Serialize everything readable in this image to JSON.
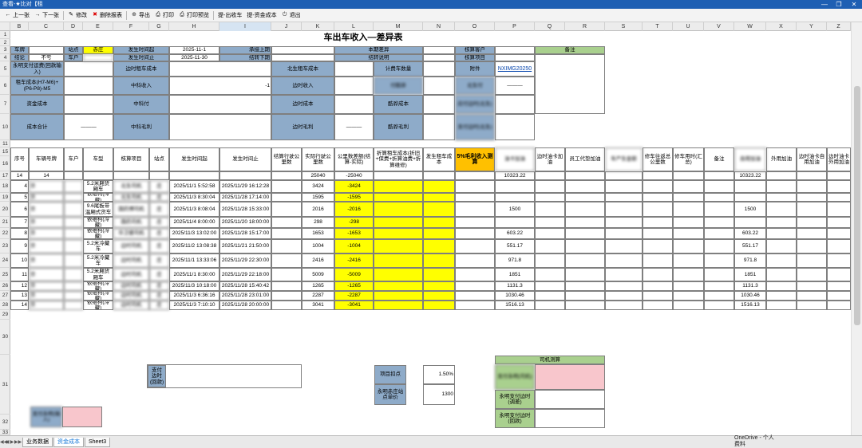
{
  "window": {
    "title": "查看-★比对【租",
    "minimize": "—",
    "restore": "❐",
    "close": "✕"
  },
  "toolbar": [
    {
      "label": "上一张",
      "icon": "arrow-left-icon",
      "glyph": "←"
    },
    {
      "label": "下一张",
      "icon": "arrow-right-icon",
      "glyph": "→"
    },
    {
      "label": "修改",
      "icon": "edit-icon",
      "glyph": "✎"
    },
    {
      "label": "删除报表",
      "icon": "delete-icon",
      "glyph": "✖"
    },
    {
      "label": "导出",
      "icon": "export-icon",
      "glyph": "⊕"
    },
    {
      "label": "打印",
      "icon": "print-icon",
      "glyph": "⎙"
    },
    {
      "label": "打印预览",
      "icon": "print-preview-icon",
      "glyph": "⎙"
    },
    {
      "label": "提-出收车",
      "icon": "",
      "glyph": ""
    },
    {
      "label": "提-资金成本",
      "icon": "",
      "glyph": ""
    },
    {
      "label": "退出",
      "icon": "exit-icon",
      "glyph": "⏻"
    }
  ],
  "columns": [
    "B",
    "C",
    "D",
    "E",
    "F",
    "G",
    "H",
    "I",
    "J",
    "K",
    "L",
    "M",
    "N",
    "O",
    "P",
    "Q",
    "R",
    "S",
    "T",
    "U",
    "V",
    "W",
    "X",
    "Y",
    "Z"
  ],
  "rows": [
    "1",
    "2",
    "3",
    "4",
    "5",
    "6",
    "7",
    "10",
    "11",
    "15",
    "16",
    "17",
    "18",
    "19",
    "20",
    "21",
    "22",
    "23",
    "24",
    "25",
    "26",
    "27",
    "28",
    "29",
    "30",
    "31",
    "32",
    "33"
  ],
  "sheet": {
    "title": "车出车收入—差异表",
    "l3": [
      "车牌",
      "",
      "站点",
      "赤庄",
      "发生时间起",
      "2025-11-1",
      "承接上期",
      "",
      "本期差异",
      "",
      "核算客户",
      "",
      "备注"
    ],
    "l4": [
      "结论",
      "不亏",
      "车户",
      "",
      "发生时间止",
      "2025-11-30",
      "结转下期",
      "",
      "结转说明",
      "",
      "核算项目",
      ""
    ],
    "l5": [
      "永明支付运费(回款输入)",
      "",
      "边时租车成本",
      "",
      "北生租车成本",
      "",
      "计费车数量",
      "",
      "附件",
      "NXIMG20250",
      ""
    ],
    "l6": [
      "租车成本(H7-M6)+(P6-P8)-M5",
      "",
      "中科收入",
      "-1",
      "边时收入",
      "",
      "付酷骅",
      "",
      "北生付",
      "———"
    ],
    "l7": [
      "资金成本",
      "",
      "中科付",
      "",
      "边时成本",
      "",
      "酷骅成本",
      "",
      "应付边时(北生)",
      ""
    ],
    "l8": [
      "成本合计",
      "———",
      "中科毛利",
      "",
      "边时毛利",
      "———",
      "酷骅毛利",
      "",
      "支付边时(北生)",
      ""
    ],
    "hdr": [
      "序号",
      "车辆号牌",
      "车户",
      "车型",
      "核算项目",
      "站点",
      "发生时间起",
      "发生时间止",
      "结算行驶公里数",
      "实际行驶公里数",
      "公里数差额(结算-实际)",
      "折算租车成本(折旧+保费+折算油费+折算维修)",
      "发生租车成本",
      "5%毛利收入测算",
      "油卡加油",
      "边时油卡加油",
      "员工代垫加油",
      "车产生金额",
      "修车往返总公里数",
      "修车用时(汇总)",
      "备注",
      "自用加油",
      "外用加油",
      "边时油卡自用加油",
      "边时油卡外用加油"
    ],
    "sum": [
      "14",
      "14",
      "",
      "",
      "",
      "",
      "",
      "",
      "",
      "25040",
      "-25040",
      "",
      "",
      "",
      "10323.22",
      "",
      "",
      "",
      "",
      "",
      "",
      "10323.22",
      "",
      "",
      ""
    ],
    "data": [
      [
        "4",
        "京",
        "",
        "5.2米厢货厢车",
        "北生司机",
        "庄",
        "2025/11/1 5:52:58",
        "2025/11/29 16:12:28",
        "",
        "3424",
        "-3424",
        "",
        "",
        "",
        "",
        "",
        "",
        "",
        "",
        "",
        "",
        "",
        "",
        "",
        ""
      ],
      [
        "5",
        "京",
        "",
        "依维柯(冷藏)",
        "北生司机",
        "庄",
        "2025/11/3 8:30:04",
        "2025/11/28 17:14:00",
        "",
        "1595",
        "-1595",
        "",
        "",
        "",
        "",
        "",
        "",
        "",
        "",
        "",
        "",
        "",
        "",
        "",
        ""
      ],
      [
        "6",
        "京",
        "",
        "9.6尾板带温厢式货车",
        "国药博司机",
        "庄",
        "2025/11/3 8:08:04",
        "2025/11/28 15:33:00",
        "",
        "2016",
        "-2016",
        "",
        "",
        "",
        "1500",
        "",
        "",
        "",
        "",
        "",
        "",
        "1500",
        "",
        "",
        ""
      ],
      [
        "7",
        "京",
        "",
        "依维柯(冷藏)",
        "国药司机",
        "庄",
        "2025/11/4 8:00:00",
        "2025/11/20 18:00:00",
        "",
        "298",
        "-298",
        "",
        "",
        "",
        "",
        "",
        "",
        "",
        "",
        "",
        "",
        "",
        "",
        "",
        ""
      ],
      [
        "8",
        "京",
        "",
        "依维柯(冷藏)",
        "华卫健司机",
        "庄",
        "2025/11/3 13:02:00",
        "2025/11/28 15:17:00",
        "",
        "1653",
        "-1653",
        "",
        "",
        "",
        "603.22",
        "",
        "",
        "",
        "",
        "",
        "",
        "603.22",
        "",
        "",
        ""
      ],
      [
        "9",
        "京",
        "",
        "5.2米冷藏车",
        "边时司机",
        "庄",
        "2025/11/2 13:08:38",
        "2025/11/21 21:50:00",
        "",
        "1004",
        "-1004",
        "",
        "",
        "",
        "551.17",
        "",
        "",
        "",
        "",
        "",
        "",
        "551.17",
        "",
        "",
        ""
      ],
      [
        "10",
        "京",
        "",
        "5.2米冷藏车",
        "边时司机",
        "庄",
        "2025/11/1 13:33:06",
        "2025/11/29 22:30:00",
        "",
        "2416",
        "-2416",
        "",
        "",
        "",
        "971.8",
        "",
        "",
        "",
        "",
        "",
        "",
        "971.8",
        "",
        "",
        ""
      ],
      [
        "11",
        "京",
        "",
        "5.2米厢货厢车",
        "边时司机",
        "庄",
        "2025/11/1 8:30:00",
        "2025/11/29 22:18:00",
        "",
        "5009",
        "-5009",
        "",
        "",
        "",
        "1851",
        "",
        "",
        "",
        "",
        "",
        "",
        "1851",
        "",
        "",
        ""
      ],
      [
        "12",
        "京",
        "",
        "依维柯(冷藏)",
        "边时司机",
        "庄",
        "2025/11/3 10:18:00",
        "2025/11/28 15:40:42",
        "",
        "1265",
        "-1265",
        "",
        "",
        "",
        "1131.3",
        "",
        "",
        "",
        "",
        "",
        "",
        "1131.3",
        "",
        "",
        ""
      ],
      [
        "13",
        "京",
        "",
        "依维柯(冷藏)",
        "边时司机",
        "庄",
        "2025/11/3 6:36:16",
        "2025/11/28 23:01:00",
        "",
        "2287",
        "-2287",
        "",
        "",
        "",
        "1030.46",
        "",
        "",
        "",
        "",
        "",
        "",
        "1030.46",
        "",
        "",
        ""
      ],
      [
        "14",
        "京",
        "",
        "依维柯(冷藏)",
        "边时司机",
        "庄",
        "2025/11/3 7:10:10",
        "2025/11/28 20:00:00",
        "",
        "3041",
        "-3041",
        "",
        "",
        "",
        "1516.13",
        "",
        "",
        "",
        "",
        "",
        "",
        "1516.13",
        "",
        "",
        ""
      ]
    ],
    "b1": "支付边时(回款)",
    "b2": "支付永明(输入)",
    "b3": [
      "项目扣点",
      "1.50%",
      "永明赤庄站点单价",
      "1300"
    ],
    "b4": [
      "司机测算",
      "支付永明(司机)",
      "永明支付边时(调差)",
      "永明支付边时(回款)"
    ]
  },
  "sheet_tabs": [
    "业务数据",
    "资金成本",
    "Sheet3"
  ],
  "nav": [
    "◀◀",
    "◀",
    "▶",
    "▶▶"
  ],
  "onedrive": "OneDrive - 个人\n费料"
}
